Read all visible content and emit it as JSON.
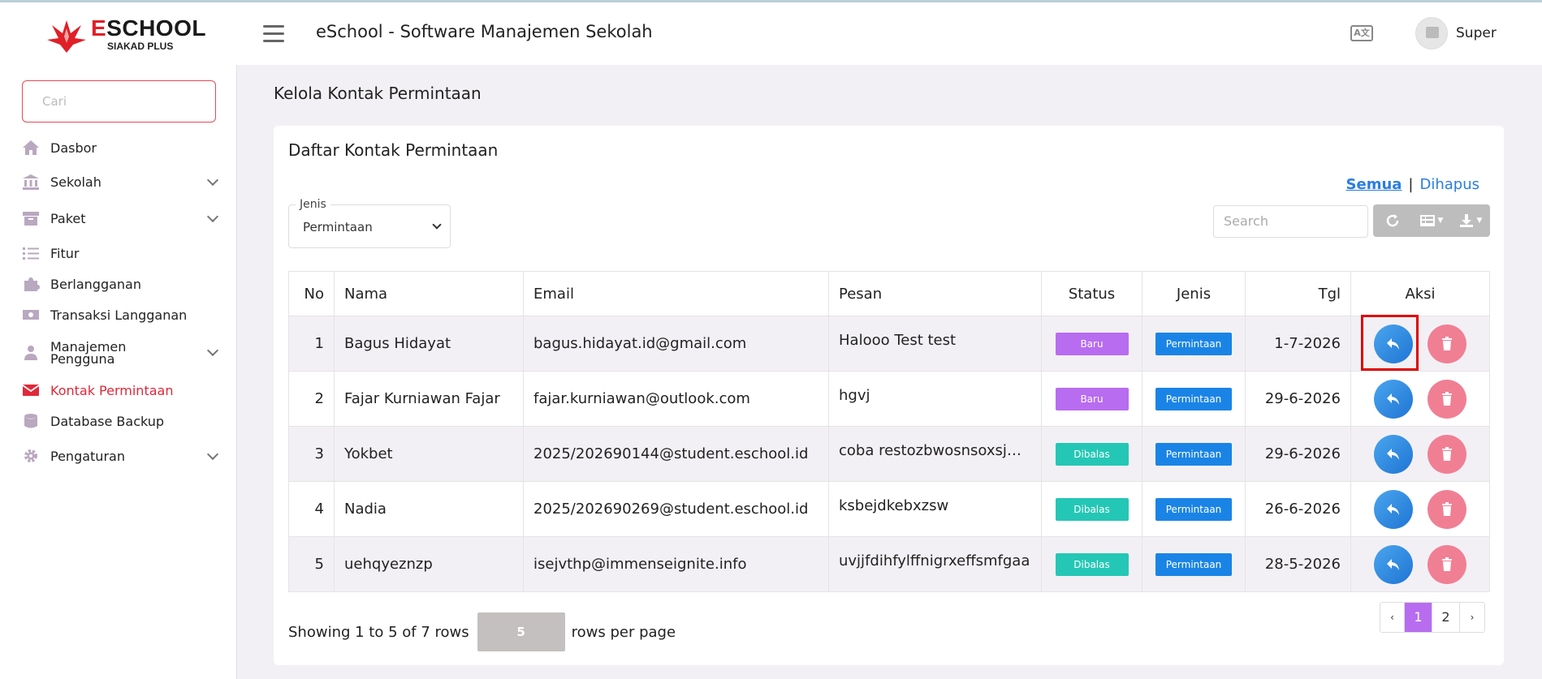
{
  "header": {
    "logo_title": "ESCHOOL",
    "logo_title_e": "E",
    "logo_title_rest": "SCHOOL",
    "logo_sub": "SIAKAD PLUS",
    "app_title": "eSchool - Software Manajemen Sekolah",
    "lang_icon_text": "A文",
    "user_name": "Super"
  },
  "sidebar": {
    "search_placeholder": "Cari",
    "items": [
      {
        "label": "Dasbor",
        "icon": "home-icon",
        "expandable": false
      },
      {
        "label": "Sekolah",
        "icon": "bank-icon",
        "expandable": true
      },
      {
        "label": "Paket",
        "icon": "archive-icon",
        "expandable": true
      },
      {
        "label": "Fitur",
        "icon": "list-icon",
        "expandable": false
      },
      {
        "label": "Berlangganan",
        "icon": "puzzle-icon",
        "expandable": false
      },
      {
        "label": "Transaksi Langganan",
        "icon": "money-icon",
        "expandable": false
      },
      {
        "label": "Manajemen Pengguna",
        "icon": "users-icon",
        "expandable": true
      },
      {
        "label": "Kontak Permintaan",
        "icon": "mail-icon",
        "expandable": false,
        "active": true
      },
      {
        "label": "Database Backup",
        "icon": "database-icon",
        "expandable": false
      },
      {
        "label": "Pengaturan",
        "icon": "gear-icon",
        "expandable": true
      }
    ]
  },
  "main": {
    "page_title": "Kelola Kontak Permintaan",
    "card_title": "Daftar Kontak Permintaan",
    "links": {
      "semua": "Semua",
      "separator": "|",
      "dihapus": "Dihapus"
    },
    "jenis": {
      "label": "Jenis",
      "value": "Permintaan"
    },
    "table_search_placeholder": "Search",
    "columns": [
      "No",
      "Nama",
      "Email",
      "Pesan",
      "Status",
      "Jenis",
      "Tgl",
      "Aksi"
    ],
    "rows": [
      {
        "no": "1",
        "nama": "Bagus Hidayat",
        "email": "bagus.hidayat.id@gmail.com",
        "pesan": "Halooo Test test",
        "status": "Baru",
        "jenis": "Permintaan",
        "tgl": "1-7-2026"
      },
      {
        "no": "2",
        "nama": "Fajar Kurniawan Fajar",
        "email": "fajar.kurniawan@outlook.com",
        "pesan": "hgvj",
        "status": "Baru",
        "jenis": "Permintaan",
        "tgl": "29-6-2026"
      },
      {
        "no": "3",
        "nama": "Yokbet",
        "email": "2025/202690144@student.eschool.id",
        "pesan": "coba restozbwosnsoxsjbsbsx",
        "status": "Dibalas",
        "jenis": "Permintaan",
        "tgl": "29-6-2026"
      },
      {
        "no": "4",
        "nama": "Nadia",
        "email": "2025/202690269@student.eschool.id",
        "pesan": "ksbejdkebxzsw",
        "status": "Dibalas",
        "jenis": "Permintaan",
        "tgl": "26-6-2026"
      },
      {
        "no": "5",
        "nama": "uehqyeznzp",
        "email": "isejvthp@immenseignite.info",
        "pesan": "uvjjfdihfylffnigrxeffsmfgaa",
        "status": "Dibalas",
        "jenis": "Permintaan",
        "tgl": "28-5-2026"
      }
    ],
    "footer": {
      "showing": "Showing 1 to 5 of 7 rows",
      "per_page": "5",
      "rows_per_page": "rows per page"
    },
    "pagination": {
      "prev": "‹",
      "pages": [
        "1",
        "2"
      ],
      "next": "›",
      "active": "1"
    }
  },
  "colors": {
    "accent_red": "#e0283a",
    "badge_baru": "#b86cf0",
    "badge_dibalas": "#24c7b5",
    "badge_permintaan": "#1a84e6",
    "reply_button": "#2a86e0",
    "delete_button": "#f07f94"
  }
}
